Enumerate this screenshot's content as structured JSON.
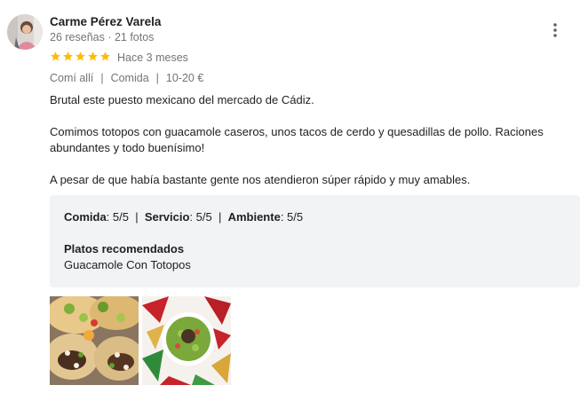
{
  "review": {
    "author": {
      "name": "Carme Pérez Varela",
      "meta": "26 reseñas · 21 fotos",
      "avatar_icon": "profile-photo"
    },
    "rating_stars": 5,
    "date": "Hace 3 meses",
    "attributes": [
      "Comí allí",
      "Comida",
      "10-20 €"
    ],
    "attribute_separator": "|",
    "paragraphs": [
      "Brutal este puesto mexicano del mercado de Cádiz.",
      "Comimos totopos con guacamole caseros, unos tacos de cerdo y quesadillas de pollo. Raciones abundantes y todo buenísimo!",
      "A pesar de que había bastante gente nos atendieron súper rápido y muy amables."
    ],
    "ratings": {
      "food_label": "Comida",
      "food_value": ": 5/5",
      "service_label": "Servicio",
      "service_value": ": 5/5",
      "ambience_label": "Ambiente",
      "ambience_value": ": 5/5",
      "separator": "|"
    },
    "recommended": {
      "title": "Platos recomendados",
      "dishes": "Guacamole Con Totopos"
    },
    "photos": [
      {
        "alt": "tacos-photo"
      },
      {
        "alt": "guacamole-totopos-photo"
      }
    ]
  },
  "colors": {
    "star": "#fbbc04",
    "secondary_text": "#70757a",
    "panel_bg": "#f1f3f4"
  },
  "icons": {
    "more": "more-vert-icon",
    "star": "star-icon"
  }
}
